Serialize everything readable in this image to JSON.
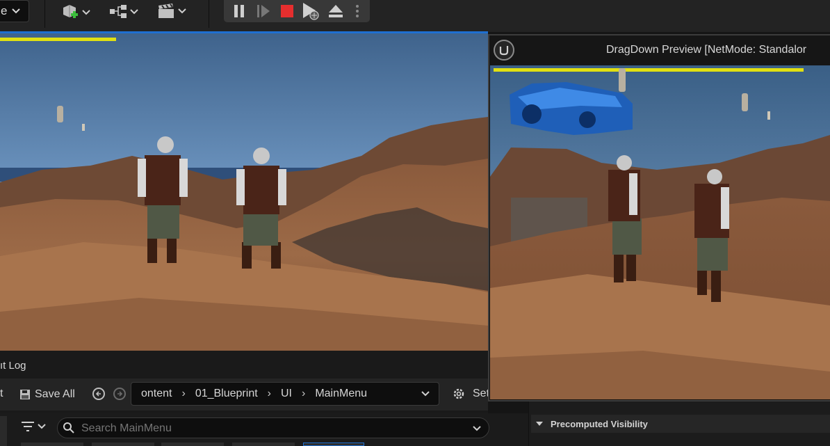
{
  "toolbar": {
    "mode_label": "e",
    "icons": [
      "add-actor-icon",
      "blueprint-icon",
      "cinematics-icon"
    ]
  },
  "play_controls": [
    "pause-icon",
    "skip-frame-icon",
    "stop-icon",
    "possess-eject-icon",
    "eject-icon",
    "more-options-icon"
  ],
  "colors": {
    "stop": "#e62e2e",
    "health_bar": "#e0e012",
    "accent": "#1f6fd1"
  },
  "bottom_panel": {
    "tab_label": "ıt Log",
    "save_all_label": "Save All",
    "left_cut_label": "t",
    "breadcrumb": [
      "ontent",
      "01_Blueprint",
      "UI",
      "MainMenu"
    ],
    "settings_label": "Set"
  },
  "search": {
    "placeholder": "Search MainMenu"
  },
  "preview": {
    "title": "DragDown Preview [NetMode: Standalor"
  },
  "details": {
    "section_header": "Precomputed Visibility"
  }
}
